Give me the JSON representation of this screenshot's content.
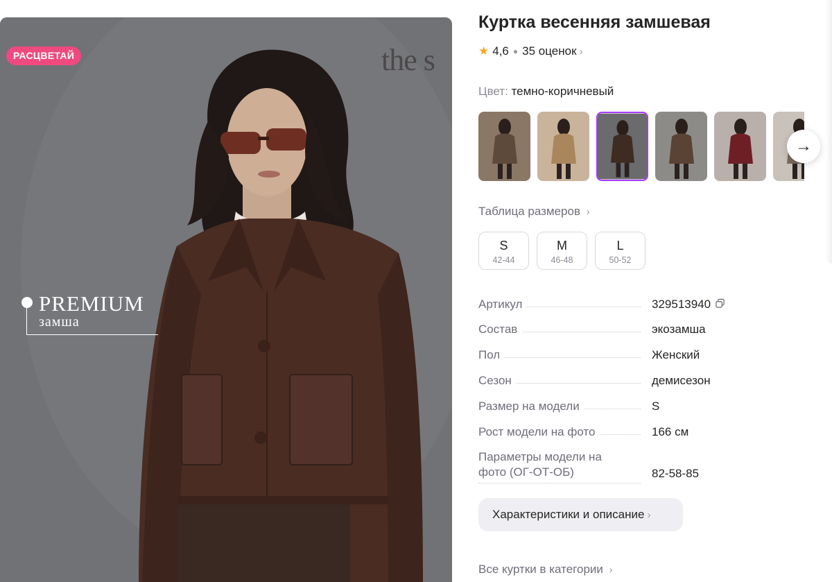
{
  "product": {
    "title": "Куртка весенняя замшевая",
    "rating": "4,6",
    "reviews": "35 оценок",
    "color_label": "Цвет:",
    "color_value": "темно-коричневый"
  },
  "photo": {
    "badge": "РАСЦВЕТАЙ",
    "brand_mark": "the s",
    "premium_title": "PREMIUM",
    "premium_sub": "замша"
  },
  "thumbnails": [
    {
      "colors": [
        "#8a7765",
        "#5e4a3a"
      ],
      "selected": false
    },
    {
      "colors": [
        "#c9b39a",
        "#a9865c"
      ],
      "selected": false
    },
    {
      "colors": [
        "#6b6a6c",
        "#3e2b22"
      ],
      "selected": true
    },
    {
      "colors": [
        "#8d8b88",
        "#5a4334"
      ],
      "selected": false
    },
    {
      "colors": [
        "#b9b0ac",
        "#6e1f26"
      ],
      "selected": false
    },
    {
      "colors": [
        "#c8c2bb",
        "#7a6a5c"
      ],
      "selected": false
    }
  ],
  "size_table_link": "Таблица размеров",
  "sizes": [
    {
      "size": "S",
      "range": "42-44"
    },
    {
      "size": "M",
      "range": "46-48"
    },
    {
      "size": "L",
      "range": "50-52"
    }
  ],
  "specs": [
    {
      "key": "Артикул",
      "value": "329513940"
    },
    {
      "key": "Состав",
      "value": "экозамша"
    },
    {
      "key": "Пол",
      "value": "Женский"
    },
    {
      "key": "Сезон",
      "value": "демисезон"
    },
    {
      "key": "Размер на модели",
      "value": "S"
    },
    {
      "key": "Рост модели на фото",
      "value": "166 см"
    },
    {
      "key": "Параметры модели на",
      "key2": "фото (ОГ-ОТ-ОБ)",
      "value": "82-58-85"
    }
  ],
  "description_button": "Характеристики и описание",
  "all_category_link": "Все куртки в категории",
  "accent_colors": {
    "badge": "#ee4a7f",
    "selected_border": "#a73afd",
    "star": "#f6a623"
  }
}
